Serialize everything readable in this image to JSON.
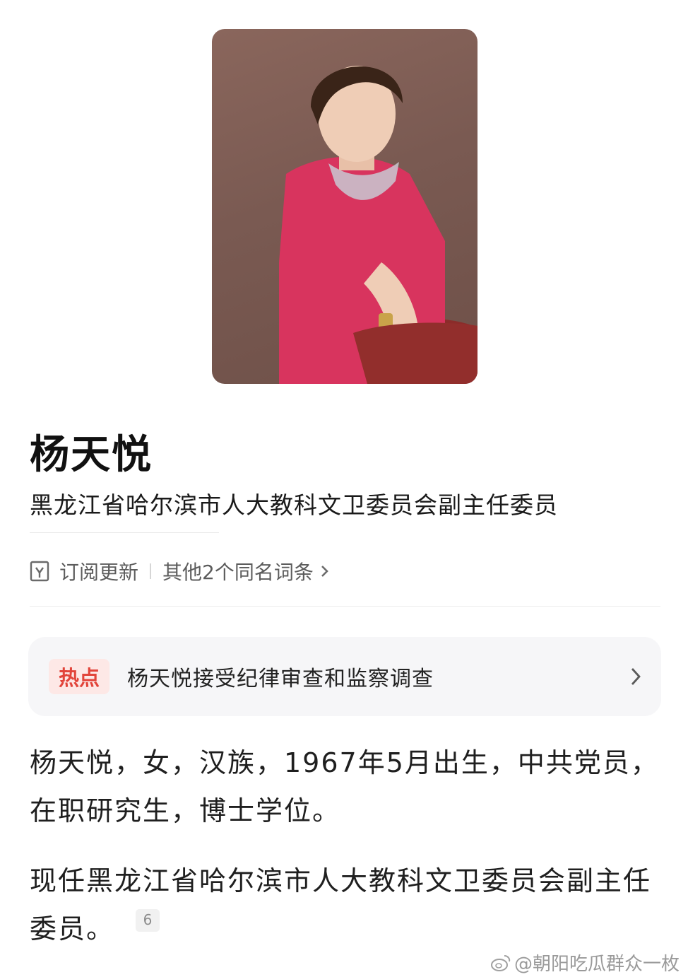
{
  "person": {
    "name": "杨天悦",
    "title": "黑龙江省哈尔滨市人大教科文卫委员会副主任委员"
  },
  "actions": {
    "subscribe_label": "订阅更新",
    "same_name_label": "其他2个同名词条"
  },
  "hot": {
    "badge": "热点",
    "text": "杨天悦接受纪律审查和监察调查"
  },
  "paragraphs": {
    "p1": "杨天悦，女，汉族，1967年5月出生，中共党员，在职研究生，博士学位。",
    "p2": "现任黑龙江省哈尔滨市人大教科文卫委员会副主任委员。",
    "citation": "6"
  },
  "watermark": {
    "text": "@朝阳吃瓜群众一枚"
  },
  "colors": {
    "hot_badge_text": "#e2443a",
    "hot_badge_bg": "#fde8e6",
    "hot_card_bg": "#f6f6f8"
  }
}
